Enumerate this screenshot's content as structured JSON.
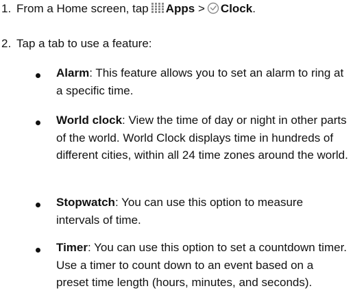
{
  "steps": [
    {
      "number": "1.",
      "prefix": "From a Home screen, tap",
      "apps_label": "Apps",
      "separator": ">",
      "clock_label": "Clock",
      "suffix": ".",
      "icons": [
        "apps-grid-icon",
        "clock-icon"
      ]
    },
    {
      "number": "2.",
      "text": "Tap a tab to use a feature:"
    }
  ],
  "features": [
    {
      "name": "Alarm",
      "description": ": This feature allows you to set an alarm to ring at a specific time."
    },
    {
      "name": "World clock",
      "description": ": View the time of day or night in other parts of the world. World Clock displays time in hundreds of different cities, within all 24 time zones around the world."
    },
    {
      "name": "Stopwatch",
      "description": ": You can use this option to measure intervals of time."
    },
    {
      "name": "Timer",
      "description": ": You can use this option to set a countdown timer. Use a timer to count down to an event based on a preset time length (hours, minutes, and seconds)."
    }
  ],
  "colors": {
    "text": "#111111",
    "icon_gray": "#8a8a8a",
    "background": "#ffffff"
  }
}
